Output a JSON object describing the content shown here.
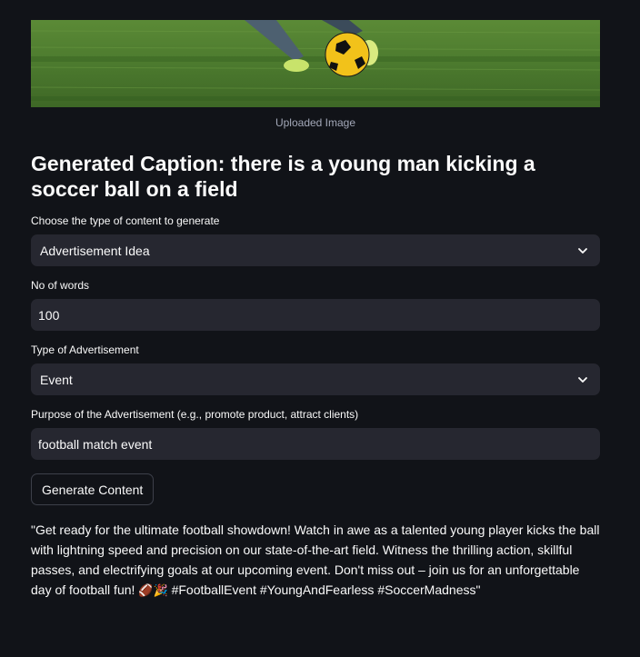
{
  "image": {
    "caption": "Uploaded Image"
  },
  "generated_caption": "Generated Caption: there is a young man kicking a soccer ball on a field",
  "content_type": {
    "label": "Choose the type of content to generate",
    "value": "Advertisement Idea"
  },
  "words": {
    "label": "No of words",
    "value": "100"
  },
  "ad_type": {
    "label": "Type of Advertisement",
    "value": "Event"
  },
  "purpose": {
    "label": "Purpose of the Advertisement (e.g., promote product, attract clients)",
    "value": "football match event"
  },
  "generate_button": {
    "label": "Generate Content"
  },
  "output": {
    "text_before_emoji": "\"Get ready for the ultimate football showdown! Watch in awe as a talented young player kicks the ball with lightning speed and precision on our state-of-the-art field. Witness the thrilling action, skillful passes, and electrifying goals at our upcoming event. Don't miss out – join us for an unforgettable day of football fun! ",
    "emoji": "🏈🎉",
    "text_after_emoji": " #FootballEvent #YoungAndFearless #SoccerMadness\""
  },
  "colors": {
    "background": "#111318",
    "field_bg": "#262730",
    "grass": "#4c7a2e",
    "ball_yellow": "#f2c21a"
  },
  "icons": {
    "select_chevron": "chevron-down-icon"
  }
}
